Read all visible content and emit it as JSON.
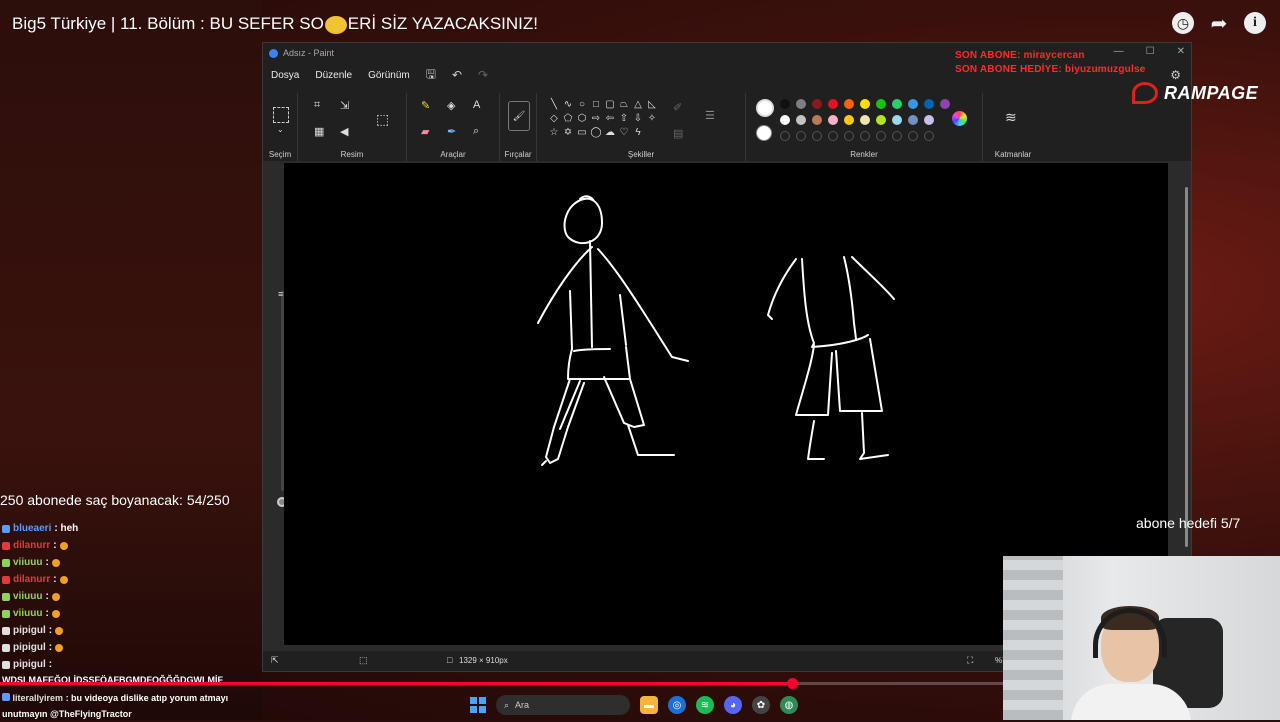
{
  "video": {
    "title": "Big5 Türkiye | 11. Bölüm : BU SEFER SO",
    "title_rest": "ERİ SİZ YAZACAKSINIZ!",
    "icons": [
      "clock-icon",
      "share-icon",
      "info-icon"
    ],
    "progress_fraction": 0.79
  },
  "paint": {
    "window_title": "Adsız - Paint",
    "menu": [
      "Dosya",
      "Düzenle",
      "Görünüm"
    ],
    "groups": {
      "selection": "Seçim",
      "image": "Resim",
      "tools": "Araçlar",
      "brushes": "Fırçalar",
      "shapes": "Şekiller",
      "colors": "Renkler",
      "layers": "Katmanlar"
    },
    "canvas_size": "1329 × 910px",
    "zoom": "%7",
    "palette_row1": [
      "#111111",
      "#7f7f7f",
      "#8b1a1a",
      "#e81123",
      "#f7630c",
      "#fce100",
      "#16c60c",
      "#2bd069",
      "#3a96dd",
      "#0063b1",
      "#8e44ad"
    ],
    "palette_row2": [
      "#ffffff",
      "#c3c3c3",
      "#b97a57",
      "#ffaec9",
      "#ffc90e",
      "#efe4b0",
      "#b5e61d",
      "#99d9ea",
      "#7092be",
      "#c8bfe7"
    ]
  },
  "overlay": {
    "last_sub": "SON ABONE: miraycercan",
    "last_gift": "SON ABONE HEDİYE: biyuzumuzgulse",
    "brand": "RAMPAGE",
    "sub_goal": "abone hedefi 5/7",
    "hair_goal": "250 abonede saç boyanacak: 54/250"
  },
  "chat": [
    {
      "user": "blueaeri",
      "msg": ": heh",
      "color": "#5b9bff"
    },
    {
      "user": "dilanurr",
      "msg": ":",
      "color": "#e03a3a"
    },
    {
      "user": "viiuuu",
      "msg": ":",
      "color": "#8fd45a"
    },
    {
      "user": "dilanurr",
      "msg": ":",
      "color": "#e03a3a"
    },
    {
      "user": "viiuuu",
      "msg": ":",
      "color": "#8fd45a"
    },
    {
      "user": "viiuuu",
      "msg": ":",
      "color": "#8fd45a"
    },
    {
      "user": "pipigul",
      "msg": ":",
      "color": "#e0e0e0"
    },
    {
      "user": "pipigul",
      "msg": ":",
      "color": "#e0e0e0"
    },
    {
      "user": "pipigul",
      "msg": ":",
      "color": "#e0e0e0"
    }
  ],
  "chat_bottom": {
    "line1": "WDŞLMAFEĞOLİDSSFÖAFBGMDFOĞĞĞDGWLMİF",
    "user": "literallyirem",
    "line2": ": bu videoya dislike atıp yorum atmayı",
    "line3": "unutmayın @TheFlyingTractor"
  },
  "taskbar": {
    "search_placeholder": "Ara",
    "apps": [
      "file-explorer-icon",
      "edge-browser-icon",
      "spotify-icon",
      "discord-icon",
      "chatgpt-icon",
      "globe-icon"
    ]
  }
}
